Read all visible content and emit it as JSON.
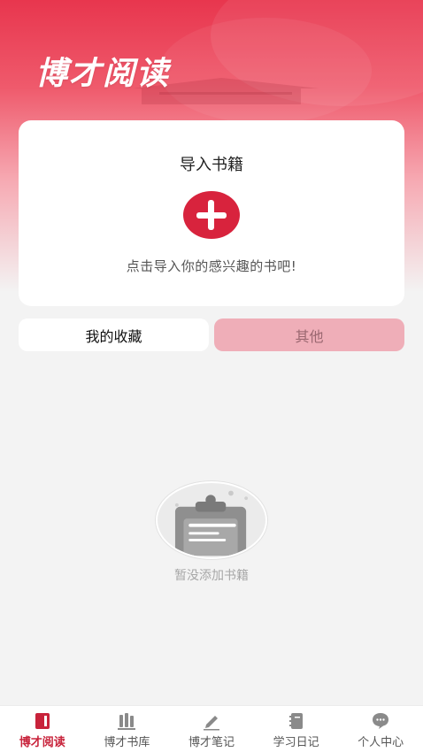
{
  "app": {
    "title": "博才阅读"
  },
  "import_card": {
    "title": "导入书籍",
    "hint": "点击导入你的感兴趣的书吧!",
    "button_icon": "plus-icon"
  },
  "tabs": [
    {
      "label": "我的收藏",
      "selected": true
    },
    {
      "label": "其他",
      "selected": false
    }
  ],
  "empty_state": {
    "text": "暂没添加书籍",
    "icon": "empty-clipboard-icon"
  },
  "bottom_nav": [
    {
      "label": "博才阅读",
      "icon": "book-icon",
      "active": true
    },
    {
      "label": "博才书库",
      "icon": "library-icon",
      "active": false
    },
    {
      "label": "博才笔记",
      "icon": "pen-icon",
      "active": false
    },
    {
      "label": "学习日记",
      "icon": "notebook-icon",
      "active": false
    },
    {
      "label": "个人中心",
      "icon": "chat-bubble-icon",
      "active": false
    }
  ],
  "colors": {
    "accent": "#d8233d",
    "tab_inactive_bg": "#efaeb8",
    "background": "#f3f3f3"
  }
}
